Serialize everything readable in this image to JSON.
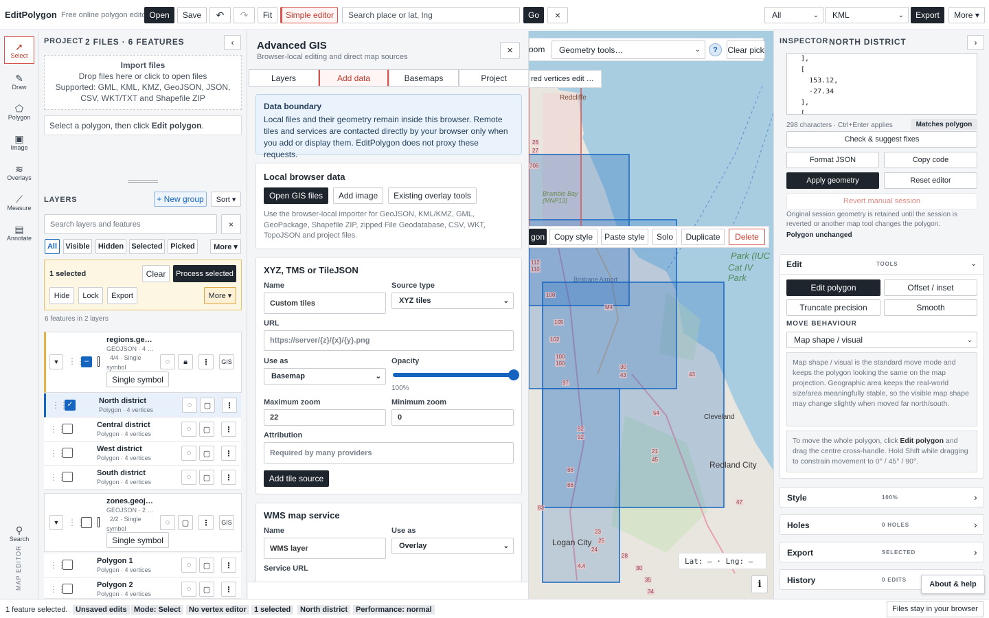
{
  "app": {
    "name": "EditPolygon",
    "tagline": "Free online polygon editor"
  },
  "topbar": {
    "open": "Open",
    "save": "Save",
    "undo_icon": "undo-icon",
    "redo_icon": "redo-icon",
    "fit": "Fit",
    "simple_editor": "Simple editor",
    "search_placeholder": "Search place or lat, lng",
    "go": "Go",
    "clear_x": "×",
    "filter_value": "All",
    "format_value": "KML",
    "export": "Export",
    "more": "More ▾"
  },
  "rail": {
    "tools": [
      "Select",
      "Draw",
      "Polygon",
      "Image",
      "Overlays",
      "Measure",
      "Annotate"
    ],
    "search": "Search",
    "footer": "MAP EDITOR"
  },
  "project": {
    "title": "PROJECT",
    "summary": "2 FILES · 6 FEATURES",
    "import_title": "Import files",
    "import_line1": "Drop files here or click to open files",
    "import_line2": "Supported: GML, KML, KMZ, GeoJSON, JSON,",
    "import_line3": "CSV, WKT/TXT and Shapefile ZIP",
    "hint_pre": "Select a polygon, then click ",
    "hint_bold": "Edit polygon",
    "hint_post": "."
  },
  "layers": {
    "title": "LAYERS",
    "new_group": "+ New group",
    "sort": "Sort ▾",
    "search_placeholder": "Search layers and features",
    "filters": [
      "All",
      "Visible",
      "Hidden",
      "Selected",
      "Picked",
      "More ▾"
    ],
    "selected_count": "1 selected",
    "clear": "Clear",
    "process": "Process selected",
    "hide": "Hide",
    "lock": "Lock",
    "export": "Export",
    "more": "More ▾",
    "summary": "6 features in 2 layers",
    "group1": {
      "name": "regions.ge…",
      "type": "GEOJSON · 4 …",
      "count": "4/4 · Single",
      "count2": "symbol",
      "symbol": "Single symbol",
      "gis": "GIS"
    },
    "group2": {
      "name": "zones.geoj…",
      "type": "GEOJSON · 2 …",
      "count": "2/2 · Single",
      "count2": "symbol",
      "symbol": "Single symbol",
      "gis": "GIS"
    },
    "features": [
      {
        "name": "North district",
        "sub": "Polygon · 4 vertices"
      },
      {
        "name": "Central district",
        "sub": "Polygon · 4 vertices"
      },
      {
        "name": "West district",
        "sub": "Polygon · 4 vertices"
      },
      {
        "name": "South district",
        "sub": "Polygon · 4 vertices"
      },
      {
        "name": "Polygon 1",
        "sub": "Polygon · 4 vertices"
      },
      {
        "name": "Polygon 2",
        "sub": "Polygon · 4 vertices"
      }
    ]
  },
  "gis": {
    "title": "Advanced GIS",
    "subtitle": "Browser-local editing and direct map sources",
    "tabs": [
      "Layers",
      "Add data",
      "Basemaps",
      "Project"
    ],
    "boundary_title": "Data boundary",
    "boundary_text": "Local files and their geometry remain inside this browser. Remote tiles and services are contacted directly by your browser only when you add or display them. EditPolygon does not proxy these requests.",
    "local_title": "Local browser data",
    "open_gis": "Open GIS files",
    "add_image": "Add image",
    "existing": "Existing overlay tools",
    "local_text": "Use the browser-local importer for GeoJSON, KML/KMZ, GML, GeoPackage, Shapefile ZIP, zipped File Geodatabase, CSV, WKT, TopoJSON and project files.",
    "xyz_title": "XYZ, TMS or TileJSON",
    "name_label": "Name",
    "name_value": "Custom tiles",
    "source_label": "Source type",
    "source_value": "XYZ tiles",
    "url_label": "URL",
    "url_placeholder": "https://server/{z}/{x}/{y}.png",
    "useas_label": "Use as",
    "useas_value": "Basemap",
    "opacity_label": "Opacity",
    "opacity_value": "100%",
    "opacity": 1.0,
    "maxzoom_label": "Maximum zoom",
    "maxzoom_value": "22",
    "minzoom_label": "Minimum zoom",
    "minzoom_value": "0",
    "attr_label": "Attribution",
    "attr_placeholder": "Required by many providers",
    "add_tile": "Add tile source",
    "wms_title": "WMS map service",
    "wms_name_label": "Name",
    "wms_name_value": "WMS layer",
    "wms_useas_label": "Use as",
    "wms_useas_value": "Overlay",
    "wms_url_label": "Service URL"
  },
  "map": {
    "zoom": "oom",
    "geometry_tools": "Geometry tools…",
    "help": "?",
    "clear_pick": "Clear pick",
    "vertices_chip": "red vertices edit …",
    "ctx": [
      "gon",
      "Copy style",
      "Paste style",
      "Solo",
      "Duplicate",
      "Delete"
    ],
    "latlng": "Lat: — · Lng: —",
    "info": "i",
    "places": [
      "Redcliffe",
      "Bramble Bay (MNP13)",
      "Brisbane Airport",
      "Park (IUC",
      "Cat IV Park",
      "Cleveland",
      "Redland City",
      "Logan City"
    ],
    "roads": [
      "26",
      "27",
      "706",
      "112",
      "110",
      "108",
      "105",
      "102",
      "100",
      "100",
      "97",
      "92",
      "92",
      "88",
      "86",
      "83",
      "M4",
      "30",
      "43",
      "43",
      "54",
      "21",
      "45",
      "47",
      "28",
      "30",
      "35",
      "34",
      "4.4",
      "23",
      "25",
      "24"
    ]
  },
  "inspector": {
    "title": "INSPECTOR",
    "feature": "NORTH DISTRICT",
    "code": [
      "  ],",
      "  [",
      "    153.12,",
      "    -27.34",
      "  ],",
      "  ["
    ],
    "chars": "298 characters · Ctrl+Enter applies",
    "matches": "Matches polygon",
    "check": "Check & suggest fixes",
    "format": "Format JSON",
    "copy": "Copy code",
    "apply": "Apply geometry",
    "reset": "Reset editor",
    "revert": "Revert manual session",
    "revert_note": "Original session geometry is retained until the session is reverted or another map tool changes the polygon.",
    "unchanged": "Polygon unchanged",
    "edit_title": "Edit",
    "tools_label": "TOOLS",
    "edit_polygon": "Edit polygon",
    "offset": "Offset / inset",
    "truncate": "Truncate precision",
    "smooth": "Smooth",
    "move_title": "MOVE BEHAVIOUR",
    "move_value": "Map shape / visual",
    "move_note": "Map shape / visual is the standard move mode and keeps the polygon looking the same on the map projection. Geographic area keeps the real-world size/area meaningfully stable, so the visible map shape may change slightly when moved far north/south.",
    "move_tip_pre": "To move the whole polygon, click ",
    "move_tip_bold": "Edit polygon",
    "move_tip_post": " and drag the centre cross-handle. Hold Shift while dragging to constrain movement to 0° / 45° / 90°.",
    "sections": [
      {
        "name": "Style",
        "meta": "100%"
      },
      {
        "name": "Holes",
        "meta": "0 HOLES"
      },
      {
        "name": "Export",
        "meta": "SELECTED"
      },
      {
        "name": "History",
        "meta": "0 EDITS"
      }
    ],
    "about": "About & help"
  },
  "status": {
    "text": "1 feature selected.",
    "chips": [
      "Unsaved edits",
      "Mode: Select",
      "No vertex editor",
      "1 selected",
      "North district",
      "Performance: normal"
    ],
    "right": "Files stay in your browser"
  },
  "colors": {
    "accent": "#1e252d",
    "danger": "#d9534f",
    "poly": "#1565c0",
    "map_water": "#a9cde0",
    "map_land": "#e9e6df"
  }
}
